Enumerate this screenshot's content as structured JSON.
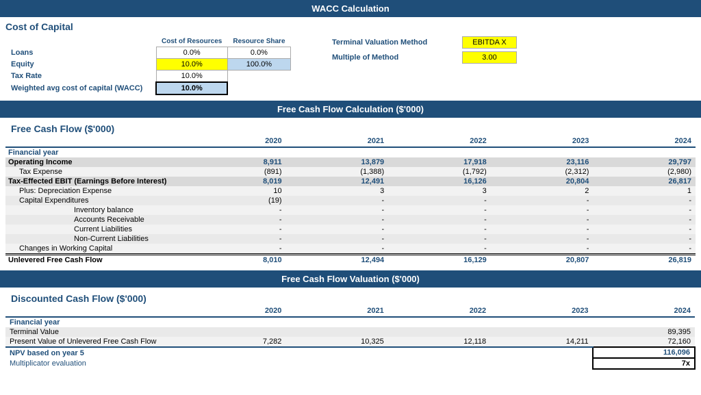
{
  "page": {
    "main_header": "WACC Calculation",
    "fcf_header": "Free Cash Flow Calculation ($'000)",
    "val_header": "Free Cash Flow Valuation ($'000)"
  },
  "wacc": {
    "section_title": "Cost of Capital",
    "col_resources": "Cost of Resources",
    "col_share": "Resource Share",
    "rows": [
      {
        "label": "Loans",
        "cost": "0.0%",
        "share": "0.0%",
        "cost_style": "white",
        "share_style": "white"
      },
      {
        "label": "Equity",
        "cost": "10.0%",
        "share": "100.0%",
        "cost_style": "yellow",
        "share_style": "blue"
      },
      {
        "label": "Tax Rate",
        "cost": "10.0%",
        "share": "",
        "cost_style": "white",
        "share_style": "none"
      },
      {
        "label": "Weighted avg cost of capital (WACC)",
        "cost": "10.0%",
        "share": "",
        "cost_style": "bold",
        "share_style": "none"
      }
    ],
    "terminal_label1": "Terminal Valuation Method",
    "terminal_value1": "EBITDA X",
    "terminal_label2": "Multiple of Method",
    "terminal_value2": "3.00"
  },
  "fcf": {
    "section_title": "Free Cash Flow ($'000)",
    "years": [
      "2020",
      "2021",
      "2022",
      "2023",
      "2024"
    ],
    "rows": [
      {
        "label": "Financial year",
        "values": [
          "",
          "",
          "",
          "",
          ""
        ],
        "type": "header",
        "indent": 0
      },
      {
        "label": "Operating Income",
        "values": [
          "8,911",
          "13,879",
          "17,918",
          "23,116",
          "29,797"
        ],
        "type": "bold",
        "indent": 0
      },
      {
        "label": "Tax Expense",
        "values": [
          "(891)",
          "(1,388)",
          "(1,792)",
          "(2,312)",
          "(2,980)"
        ],
        "type": "normal",
        "indent": 1
      },
      {
        "label": "Tax-Effected EBIT (Earnings Before Interest)",
        "values": [
          "8,019",
          "12,491",
          "16,126",
          "20,804",
          "26,817"
        ],
        "type": "bold",
        "indent": 0
      },
      {
        "label": "Plus: Depreciation Expense",
        "values": [
          "10",
          "3",
          "3",
          "2",
          "1"
        ],
        "type": "normal",
        "indent": 1
      },
      {
        "label": "Capital Expenditures",
        "values": [
          "(19)",
          "-",
          "-",
          "-",
          "-"
        ],
        "type": "normal",
        "indent": 1
      },
      {
        "label": "Inventory balance",
        "values": [
          "-",
          "-",
          "-",
          "-",
          "-"
        ],
        "type": "normal",
        "indent": 3
      },
      {
        "label": "Accounts Receivable",
        "values": [
          "-",
          "-",
          "-",
          "-",
          "-"
        ],
        "type": "normal",
        "indent": 3
      },
      {
        "label": "Current Liabilities",
        "values": [
          "-",
          "-",
          "-",
          "-",
          "-"
        ],
        "type": "normal",
        "indent": 3
      },
      {
        "label": "Non-Current Liabilities",
        "values": [
          "-",
          "-",
          "-",
          "-",
          "-"
        ],
        "type": "normal",
        "indent": 3
      },
      {
        "label": "Changes in Working Capital",
        "values": [
          "-",
          "-",
          "-",
          "-",
          "-"
        ],
        "type": "normal",
        "indent": 1
      },
      {
        "label": "Unlevered Free Cash Flow",
        "values": [
          "8,010",
          "12,494",
          "16,129",
          "20,807",
          "26,819"
        ],
        "type": "total",
        "indent": 0
      }
    ]
  },
  "valuation": {
    "section_title": "Discounted Cash Flow ($'000)",
    "years": [
      "2020",
      "2021",
      "2022",
      "2023",
      "2024"
    ],
    "rows": [
      {
        "label": "Financial year",
        "values": [
          "",
          "",
          "",
          "",
          ""
        ],
        "type": "header"
      },
      {
        "label": "Terminal Value",
        "values": [
          "",
          "",
          "",
          "",
          "89,395"
        ],
        "type": "normal"
      },
      {
        "label": "Present Value of Unlevered Free Cash Flow",
        "values": [
          "7,282",
          "10,325",
          "12,118",
          "14,211",
          "72,160"
        ],
        "type": "normal"
      },
      {
        "label": "NPV based on year 5",
        "values": [
          "",
          "",
          "",
          "",
          "116,096"
        ],
        "type": "npv"
      },
      {
        "label": "Multiplicator evaluation",
        "values": [
          "",
          "",
          "",
          "",
          "7x"
        ],
        "type": "mult"
      }
    ]
  }
}
